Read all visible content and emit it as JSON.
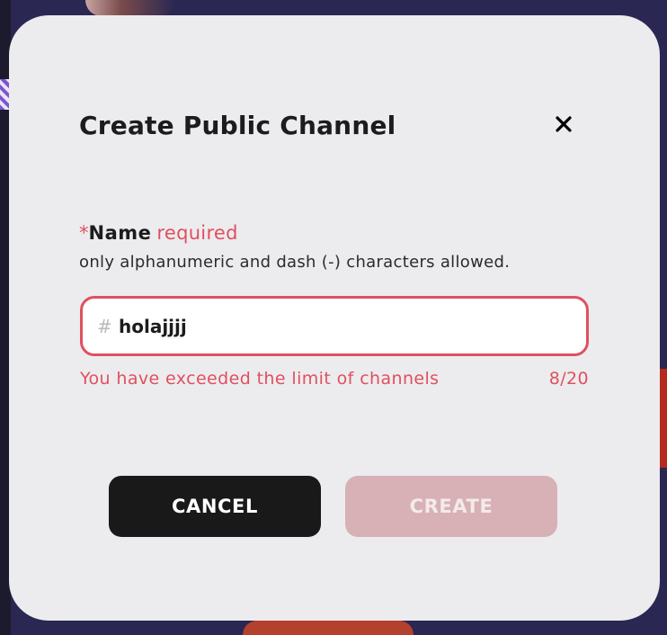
{
  "dialog": {
    "title": "Create Public Channel",
    "close_icon": "close-icon"
  },
  "form": {
    "name_asterisk": "*",
    "name_label": "Name",
    "name_required": "required",
    "name_hint": "only alphanumeric and dash (-) characters allowed.",
    "hash_prefix": "#",
    "name_value": "holajjjj",
    "error_message": "You have exceeded the limit of channels",
    "char_count": "8/20"
  },
  "buttons": {
    "cancel_label": "CANCEL",
    "create_label": "CREATE"
  },
  "colors": {
    "error": "#e0505e",
    "modal_background": "#ececef",
    "cancel_button": "#19191a",
    "create_button_disabled": "#d7b1b5"
  }
}
